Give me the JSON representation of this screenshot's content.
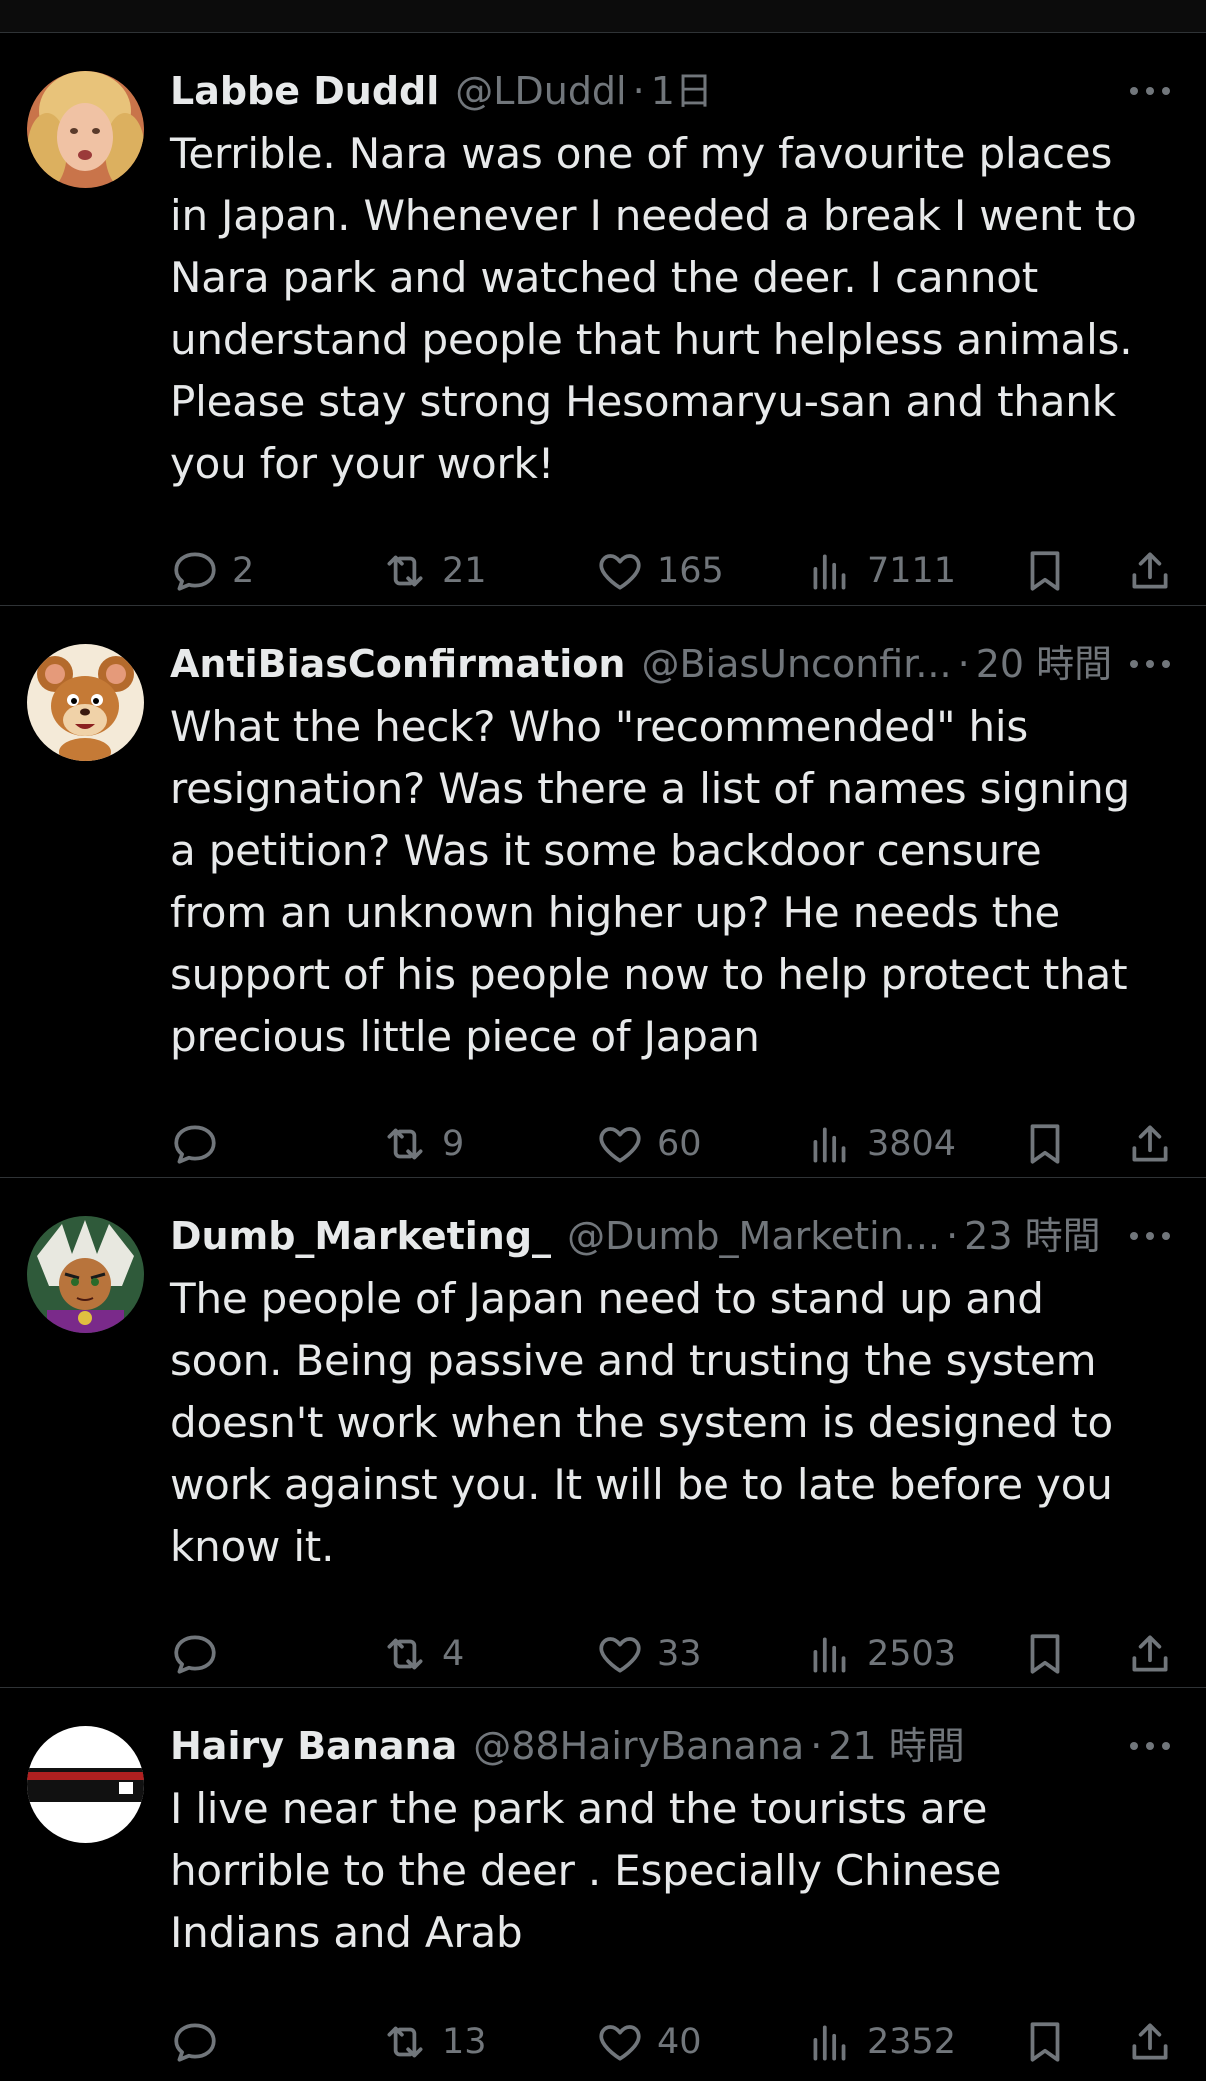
{
  "posts": [
    {
      "name": "Labbe Duddl",
      "handle": "@LDuddl",
      "dot": "·",
      "time": "1日",
      "text": "Terrible. Nara was one of my favourite places\nin Japan. Whenever I needed a break I went to\nNara park and watched the deer. I cannot\nunderstand people that hurt helpless animals.\nPlease stay strong Hesomaryu-san and thank\nyou for your work!",
      "replies": "2",
      "retweets": "21",
      "likes": "165",
      "views": "7111"
    },
    {
      "name": "AntiBiasConfirmation",
      "handle": "@BiasUnconfir...",
      "dot": "·",
      "time": "20 時間",
      "text": "What the heck? Who \"recommended\" his\nresignation? Was there a list of names signing\na petition? Was it some backdoor censure\nfrom an unknown higher up? He needs the\nsupport of his people now to help protect that\nprecious little piece of Japan",
      "replies": "",
      "retweets": "9",
      "likes": "60",
      "views": "3804"
    },
    {
      "name": "Dumb_Marketing_",
      "handle": "@Dumb_Marketin...",
      "dot": "·",
      "time": "23 時間",
      "text": "The people of Japan need to stand up and\nsoon. Being passive and trusting the system\ndoesn't work when the system is designed to\nwork against you. It will be to late before you\nknow it.",
      "replies": "",
      "retweets": "4",
      "likes": "33",
      "views": "2503"
    },
    {
      "name": "Hairy Banana",
      "handle": "@88HairyBanana",
      "dot": "·",
      "time": "21 時間",
      "text": "I live near the park and the tourists are\nhorrible to the deer . Especially Chinese\nIndians and Arab",
      "replies": "",
      "retweets": "13",
      "likes": "40",
      "views": "2352"
    }
  ],
  "icons": {
    "reply": "reply-icon",
    "retweet": "retweet-icon",
    "like": "heart-icon",
    "views": "views-chart-icon",
    "bookmark": "bookmark-icon",
    "share": "share-icon",
    "more": "more-options-icon"
  },
  "colors": {
    "background": "#000000",
    "primary_text": "#e7e9ea",
    "secondary_text": "#71767b",
    "divider": "#2f3336"
  }
}
